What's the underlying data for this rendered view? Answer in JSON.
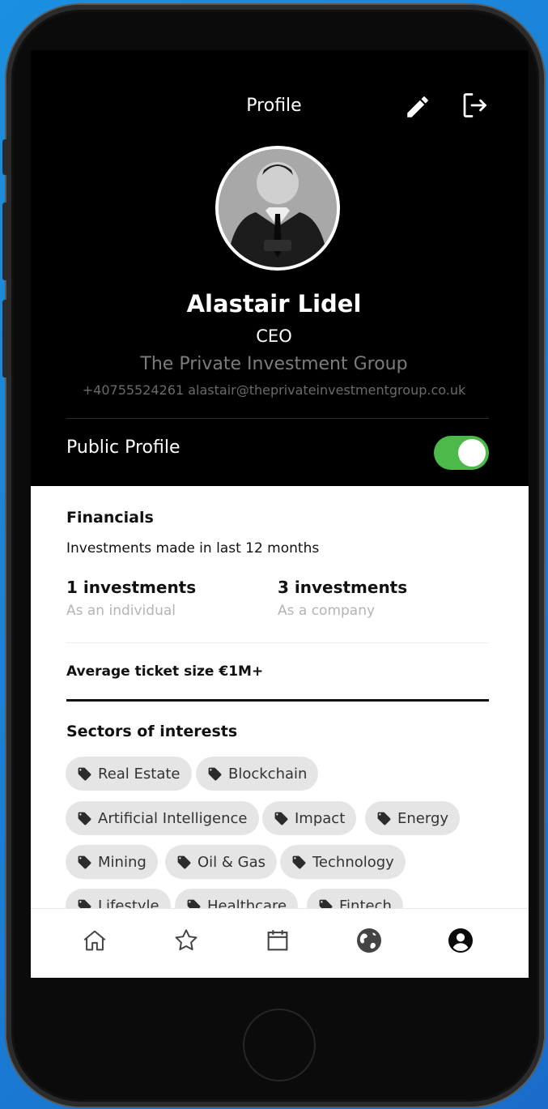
{
  "header": {
    "title": "Profile"
  },
  "profile": {
    "name": "Alastair Lidel",
    "role": "CEO",
    "company": "The Private Investment Group",
    "contact": "+40755524261  alastair@theprivateinvestmentgroup.co.uk"
  },
  "public_profile": {
    "label": "Public Profile",
    "enabled": true
  },
  "financials": {
    "title": "Financials",
    "subtitle": "Investments made in last 12 months",
    "individual": {
      "value": "1 investments",
      "label": "As an individual"
    },
    "company": {
      "value": "3 investments",
      "label": "As a company"
    },
    "ticket": "Average ticket size €1M+"
  },
  "sectors": {
    "title": "Sectors of interests",
    "tags": [
      "Real Estate",
      "Blockchain",
      "Artificial Intelligence",
      "Impact",
      "Energy",
      "Mining",
      "Oil & Gas",
      "Technology",
      "Lifestyle",
      "Healthcare",
      "Fintech"
    ]
  },
  "icons": {
    "edit": "pencil-icon",
    "logout": "logout-icon",
    "tag": "tag-icon",
    "tabs": [
      "home-icon",
      "star-icon",
      "calendar-icon",
      "globe-icon",
      "account-icon"
    ]
  },
  "colors": {
    "toggle_on": "#4cba4a",
    "background": "#1a7fd6"
  }
}
